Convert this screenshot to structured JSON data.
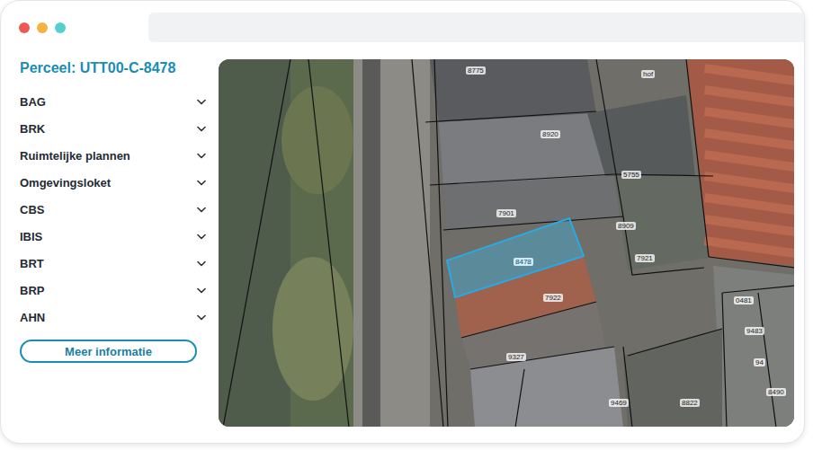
{
  "window": {
    "dots": [
      {
        "color": "#ee5a52"
      },
      {
        "color": "#f4b23e"
      },
      {
        "color": "#55d0cf"
      }
    ]
  },
  "sidebar": {
    "title": "Perceel: UTT00-C-8478",
    "items": [
      {
        "label": "BAG",
        "expanded": false
      },
      {
        "label": "BRK",
        "expanded": false
      },
      {
        "label": "Ruimtelijke plannen",
        "expanded": false
      },
      {
        "label": "Omgevingsloket",
        "expanded": false
      },
      {
        "label": "CBS",
        "expanded": false
      },
      {
        "label": "IBIS",
        "expanded": false
      },
      {
        "label": "BRT",
        "expanded": false
      },
      {
        "label": "BRP",
        "expanded": false
      },
      {
        "label": "AHN",
        "expanded": false
      }
    ],
    "button": "Meer informatie"
  },
  "map": {
    "street": "hof",
    "parcels": [
      {
        "label": "8775",
        "selected": false
      },
      {
        "label": "8920",
        "selected": false
      },
      {
        "label": "5755",
        "selected": false
      },
      {
        "label": "7901",
        "selected": false
      },
      {
        "label": "8909",
        "selected": false
      },
      {
        "label": "8478",
        "selected": true
      },
      {
        "label": "7921",
        "selected": false
      },
      {
        "label": "7922",
        "selected": false
      },
      {
        "label": "9327",
        "selected": false
      },
      {
        "label": "9469",
        "selected": false
      },
      {
        "label": "8822",
        "selected": false
      },
      {
        "label": "0481",
        "selected": false
      },
      {
        "label": "9483",
        "selected": false
      },
      {
        "label": "94",
        "selected": false
      },
      {
        "label": "8490",
        "selected": false
      }
    ]
  }
}
